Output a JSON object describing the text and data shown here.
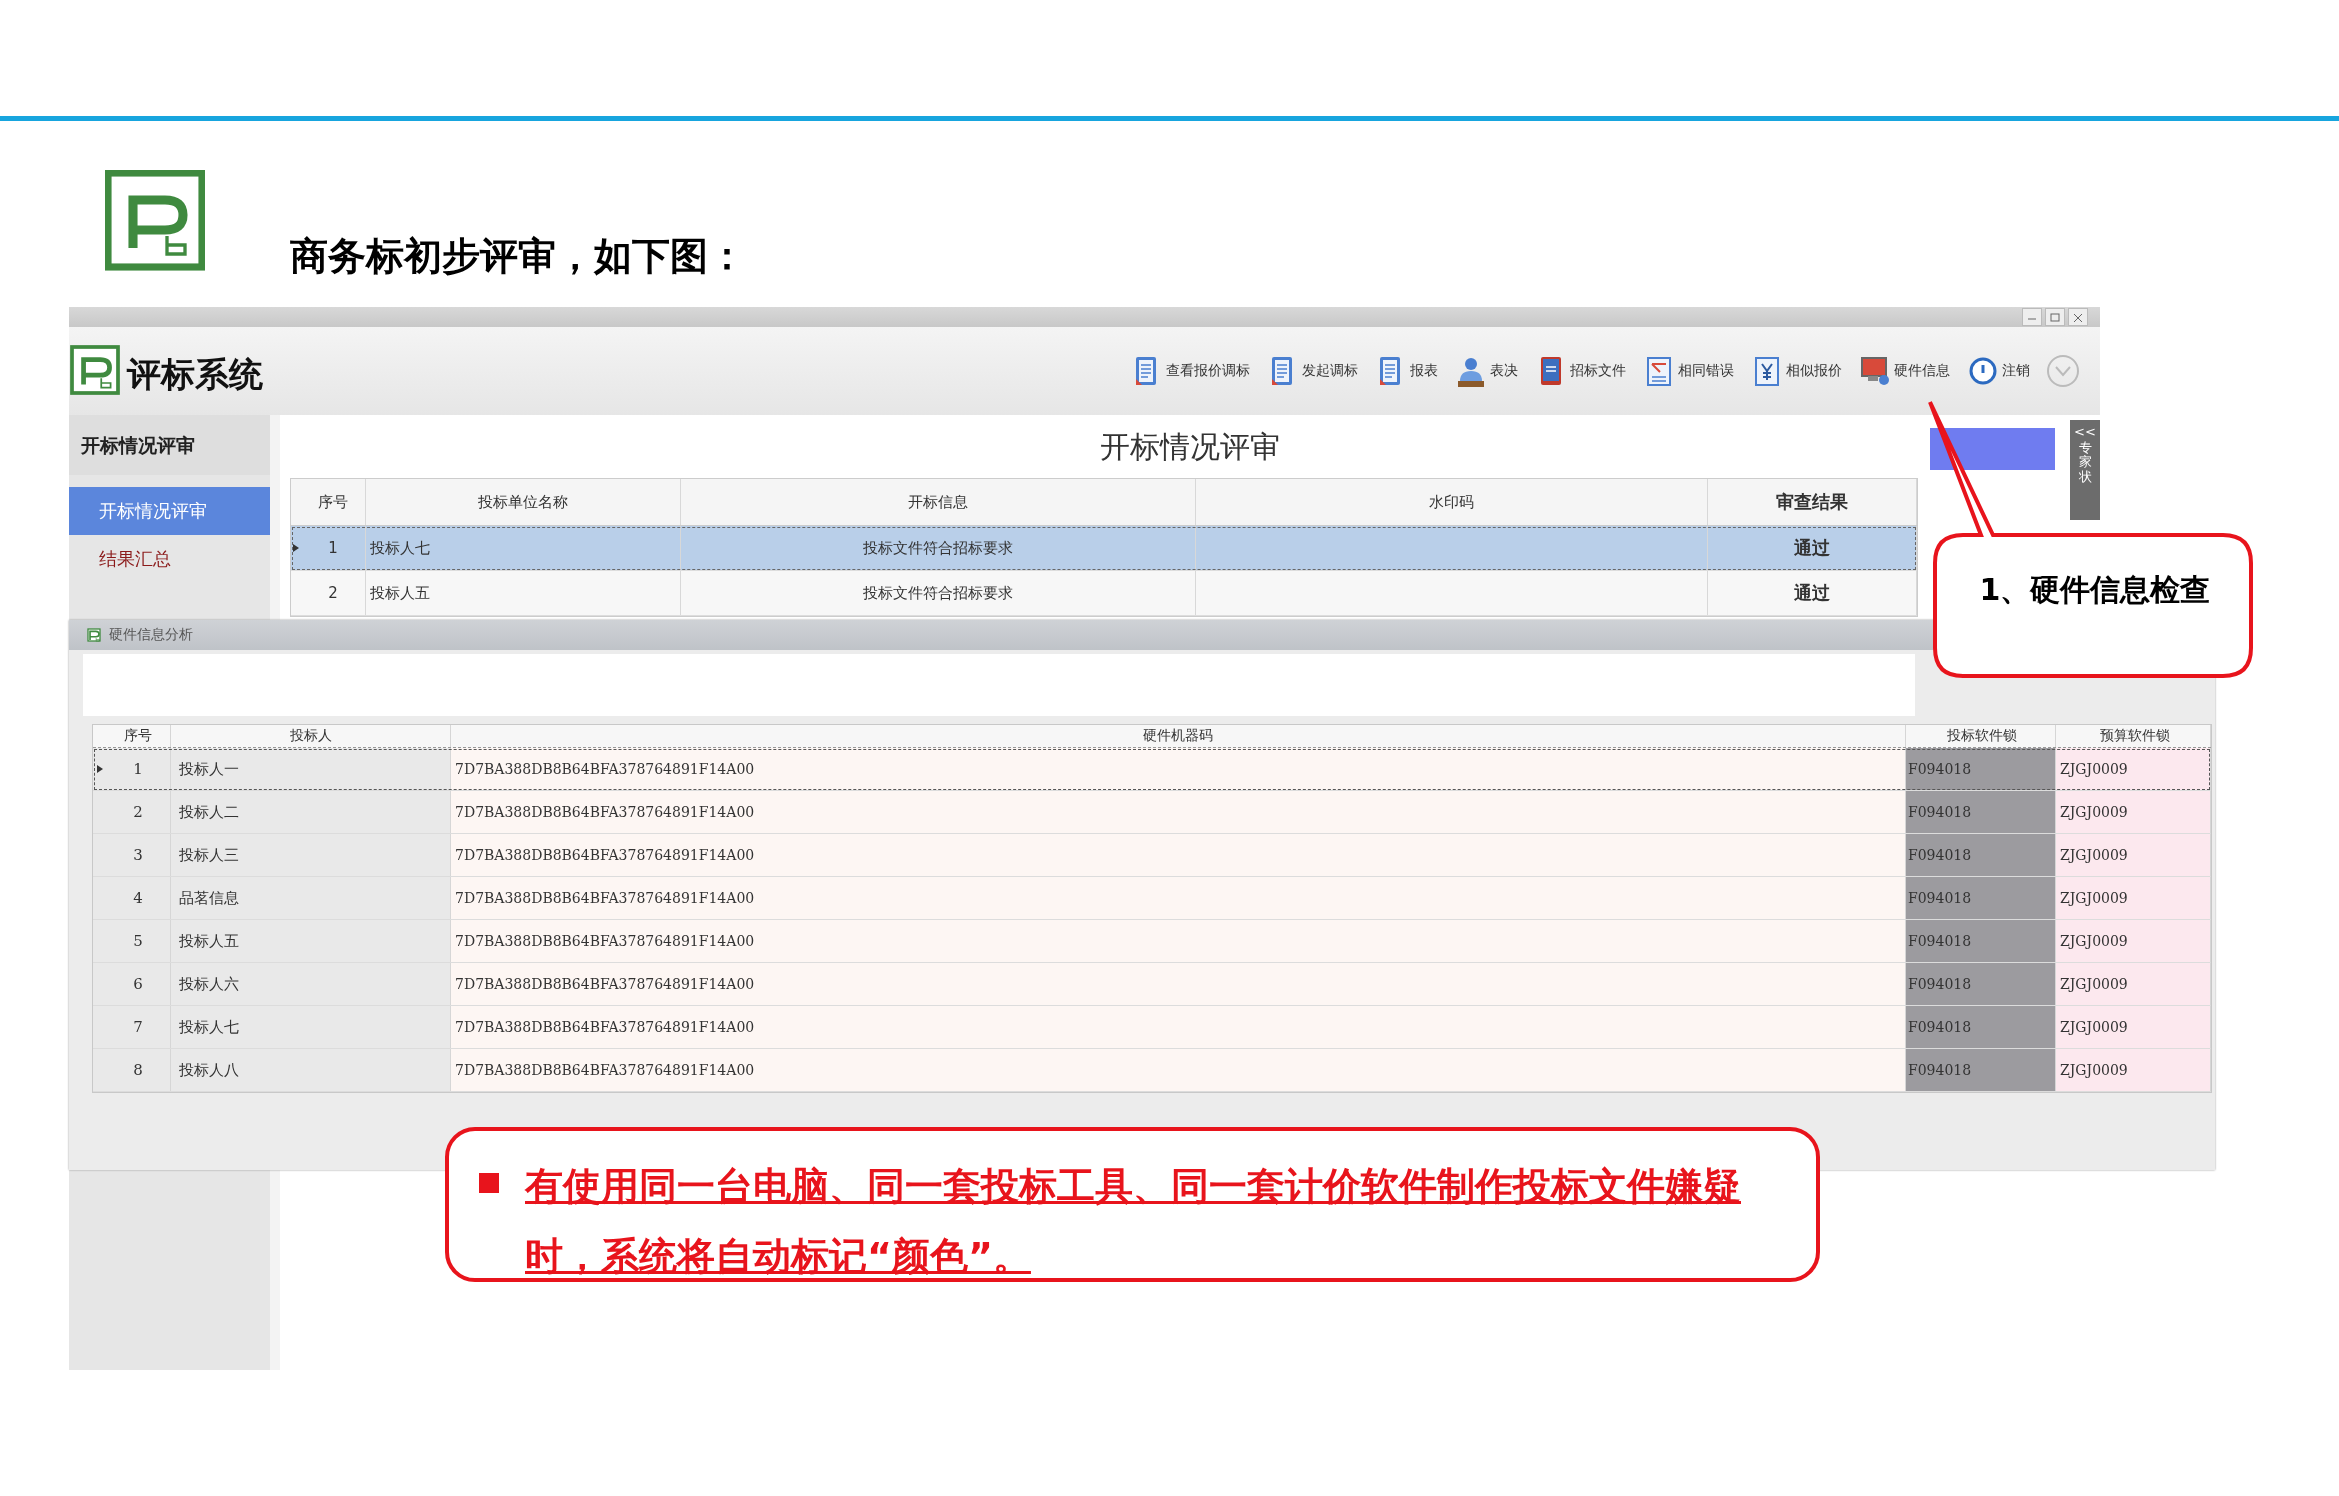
{
  "slide": {
    "heading": "商务标初步评审，如下图："
  },
  "window": {
    "app_title": "评标系统",
    "toolbar": [
      {
        "label": "查看报价调标",
        "kind": "doc"
      },
      {
        "label": "发起调标",
        "kind": "doc"
      },
      {
        "label": "报表",
        "kind": "doc"
      },
      {
        "label": "表决",
        "kind": "person"
      },
      {
        "label": "招标文件",
        "kind": "book"
      },
      {
        "label": "相同错误",
        "kind": "calc"
      },
      {
        "label": "相似报价",
        "kind": "yen"
      },
      {
        "label": "硬件信息",
        "kind": "monitor"
      },
      {
        "label": "注销",
        "kind": "power"
      }
    ],
    "sidebar": {
      "section": "开标情况评审",
      "items": [
        {
          "label": "开标情况评审",
          "selected": true
        },
        {
          "label": "结果汇总",
          "selected": false
        }
      ]
    },
    "panel": {
      "title": "开标情况评审",
      "side_tab": {
        "arrow": "<<",
        "label": "专家状"
      }
    },
    "table": {
      "columns": [
        "序号",
        "投标单位名称",
        "开标信息",
        "水印码",
        "审查结果"
      ],
      "rows": [
        {
          "no": "1",
          "name": "投标人七",
          "info": "投标文件符合招标要求",
          "result": "通过",
          "selected": true
        },
        {
          "no": "2",
          "name": "投标人五",
          "info": "投标文件符合招标要求",
          "result": "通过",
          "selected": false
        }
      ]
    }
  },
  "dialog": {
    "title": "硬件信息分析",
    "columns": [
      {
        "label": "序号"
      },
      {
        "label": "投标人"
      },
      {
        "label": "硬件机器码",
        "color": "#fdf6f3"
      },
      {
        "label": "投标软件锁",
        "color": "#9c9b9f"
      },
      {
        "label": "预算软件锁",
        "color": "#fce8ee"
      }
    ],
    "rows": [
      {
        "cells": [
          "1",
          "投标人一",
          "7D7BA388DB8B64BFA378764891F14A00",
          "F094018",
          "ZJGJ0009"
        ],
        "selected": true
      },
      {
        "cells": [
          "2",
          "投标人二",
          "7D7BA388DB8B64BFA378764891F14A00",
          "F094018",
          "ZJGJ0009"
        ],
        "selected": false
      },
      {
        "cells": [
          "3",
          "投标人三",
          "7D7BA388DB8B64BFA378764891F14A00",
          "F094018",
          "ZJGJ0009"
        ],
        "selected": false
      },
      {
        "cells": [
          "4",
          "品茗信息",
          "7D7BA388DB8B64BFA378764891F14A00",
          "F094018",
          "ZJGJ0009"
        ],
        "selected": false
      },
      {
        "cells": [
          "5",
          "投标人五",
          "7D7BA388DB8B64BFA378764891F14A00",
          "F094018",
          "ZJGJ0009"
        ],
        "selected": false
      },
      {
        "cells": [
          "6",
          "投标人六",
          "7D7BA388DB8B64BFA378764891F14A00",
          "F094018",
          "ZJGJ0009"
        ],
        "selected": false
      },
      {
        "cells": [
          "7",
          "投标人七",
          "7D7BA388DB8B64BFA378764891F14A00",
          "F094018",
          "ZJGJ0009"
        ],
        "selected": false
      },
      {
        "cells": [
          "8",
          "投标人八",
          "7D7BA388DB8B64BFA378764891F14A00",
          "F094018",
          "ZJGJ0009"
        ],
        "selected": false
      }
    ]
  },
  "callouts": [
    {
      "kind": "bubble",
      "text": "1、硬件信息检查"
    },
    {
      "kind": "note",
      "text": "有使用同一台电脑、同一套投标工具、同一套计价软件制作投标文件嫌疑时，系统将自动标记“颜色”。"
    }
  ]
}
